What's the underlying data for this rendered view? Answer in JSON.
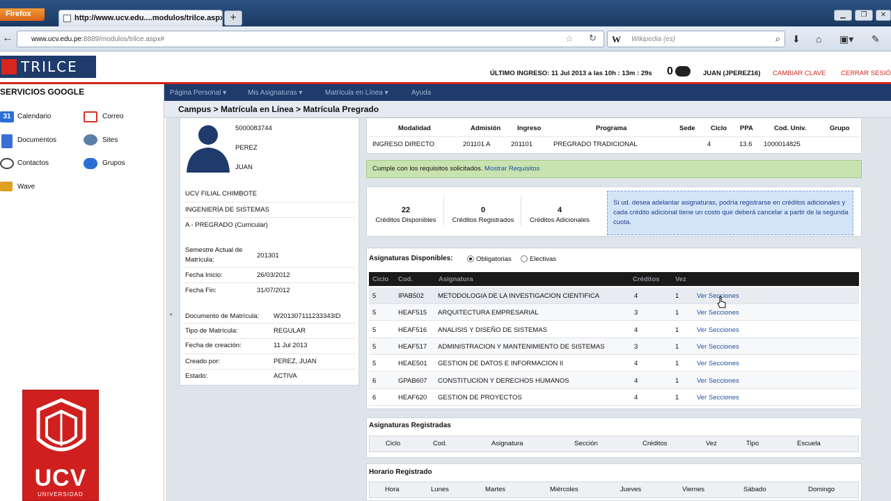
{
  "browser": {
    "firefox_label": "Firefox",
    "tab_title": "http://www.ucv.edu....modulos/trilce.aspx",
    "new_tab": "+",
    "url_host": "www.ucv.edu.pe",
    "url_rest": ":8889/modulos/trilce.aspx#",
    "search_placeholder": "Wikipedia (es)",
    "search_engine_glyph": "W"
  },
  "header": {
    "logo_text": "TRILCE",
    "last_login": "ÚLTIMO INGRESO: 11 Jul 2013 a las 10h : 13m : 29s",
    "notif_count": "0",
    "user": "JUAN (JPEREZ16)",
    "change_password": "CAMBIAR CLAVE",
    "logout": "CERRAR SESIÓ"
  },
  "google": {
    "title": "SERVICIOS GOOGLE",
    "items": [
      {
        "label": "Calendario",
        "icon": "calendar-icon",
        "color": "#2a6fd6"
      },
      {
        "label": "Correo",
        "icon": "gmail-icon",
        "color": "#d93025"
      },
      {
        "label": "Documentos",
        "icon": "docs-icon",
        "color": "#3b6fd6"
      },
      {
        "label": "Sites",
        "icon": "sites-icon",
        "color": "#5a7ea8"
      },
      {
        "label": "Contactos",
        "icon": "contacts-icon",
        "color": "#444444"
      },
      {
        "label": "Grupos",
        "icon": "groups-icon",
        "color": "#2a6fd6"
      },
      {
        "label": "Wave",
        "icon": "wave-icon",
        "color": "#e0a020"
      }
    ]
  },
  "brand": {
    "ucv": "UCV",
    "ucv_sub": "UNIVERSIDAD",
    "accent": "#d32318",
    "navy": "#1e3b6b"
  },
  "menu": [
    "Página Personal",
    "Mis Asignaturas",
    "Matrícula en Línea",
    "Ayuda"
  ],
  "breadcrumb": "Campus > Matrícula en Línea > Matrícula Pregrado",
  "profile": {
    "code": "5000083744",
    "surname": "PEREZ",
    "name": "JUAN",
    "campus": "UCV FILIAL CHIMBOTE",
    "career": "INGENIERÍA DE SISTEMAS",
    "level": "A - PREGRADO (Curricular)",
    "fields": [
      {
        "label": "Semestre Actual de Matrícula:",
        "value": "201301"
      },
      {
        "label": "Fecha Inicio:",
        "value": "26/03/2012"
      },
      {
        "label": "Fecha Fin:",
        "value": "31/07/2012"
      },
      {
        "label": "Documento de Matrícula:",
        "value": "W201307111233343ID"
      },
      {
        "label": "Tipo de Matrícula:",
        "value": "REGULAR"
      },
      {
        "label": "Fecha de creación:",
        "value": "11 Jul 2013"
      },
      {
        "label": "Creado por:",
        "value": "PEREZ, JUAN"
      },
      {
        "label": "Estado:",
        "value": "ACTIVA"
      }
    ]
  },
  "info": {
    "headers": [
      "Modalidad",
      "Admisión",
      "Ingreso",
      "Programa",
      "Sede",
      "Ciclo",
      "PPA",
      "Cod. Univ.",
      "Grupo"
    ],
    "values": [
      "INGRESO DIRECTO",
      "201101 A",
      "201101",
      "PREGRADO TRADICIONAL",
      "",
      "4",
      "13.6",
      "1000014825",
      ""
    ]
  },
  "requirements": {
    "text": "Cumple con los requisitos solicitados.",
    "link": "Mostrar Requisitos"
  },
  "credits": [
    {
      "value": "22",
      "label": "Créditos Disponibles"
    },
    {
      "value": "0",
      "label": "Créditos Registrados"
    },
    {
      "value": "4",
      "label": "Créditos Adicionales"
    }
  ],
  "extra_credits_note": "Si ud. desea adelantar asignaturas, podría registrarse en créditos adicionales y cada crédito adicional tiene un costo que deberá cancelar a partir de la segunda cuota.",
  "subjects": {
    "title": "Asignaturas Disponibles:",
    "filter_obligatory": "Obligatorias",
    "filter_elective": "Electivas",
    "headers": [
      "Ciclo",
      "Cod.",
      "Asignatura",
      "Créditos",
      "Vez"
    ],
    "action_label": "Ver Secciones",
    "rows": [
      [
        "5",
        "IPAB502",
        "METODOLOGIA DE LA INVESTIGACION CIENTIFICA",
        "4",
        "1"
      ],
      [
        "5",
        "HEAF515",
        "ARQUITECTURA EMPRESARIAL",
        "3",
        "1"
      ],
      [
        "5",
        "HEAF516",
        "ANALISIS Y DISEÑO DE SISTEMAS",
        "4",
        "1"
      ],
      [
        "5",
        "HEAF517",
        "ADMINISTRACION Y MANTENIMIENTO DE SISTEMAS",
        "3",
        "1"
      ],
      [
        "5",
        "HEAE501",
        "GESTION DE DATOS E INFORMACION II",
        "4",
        "1"
      ],
      [
        "6",
        "GPAB607",
        "CONSTITUCION Y DERECHOS HUMANOS",
        "4",
        "1"
      ],
      [
        "6",
        "HEAF620",
        "GESTION DE PROYECTOS",
        "4",
        "1"
      ]
    ]
  },
  "registered": {
    "title": "Asignaturas Registradas",
    "headers": [
      "Ciclo",
      "Cod.",
      "Asignatura",
      "Sección",
      "Créditos",
      "Vez",
      "Tipo",
      "Escuela"
    ]
  },
  "schedule": {
    "title": "Horario Registrado",
    "headers": [
      "Hora",
      "Lunes",
      "Martes",
      "Miércoles",
      "Jueves",
      "Viernes",
      "Sábado",
      "Domingo"
    ]
  }
}
